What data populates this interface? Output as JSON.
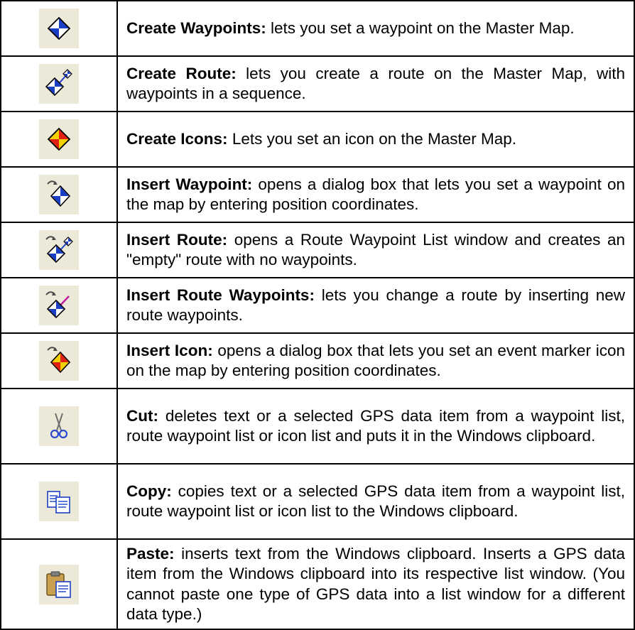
{
  "rows": [
    {
      "icon": "create-waypoint-icon",
      "title": "Create Waypoints:",
      "desc": " lets you set a waypoint on the Master Map."
    },
    {
      "icon": "create-route-icon",
      "title": "Create Route:",
      "desc": " lets you create a route on the Master Map, with waypoints in a sequence."
    },
    {
      "icon": "create-icons-icon",
      "title": "Create Icons:",
      "desc": " Lets you set an icon on the Master Map."
    },
    {
      "icon": "insert-waypoint-icon",
      "title": "Insert Waypoint:",
      "desc": " opens a dialog box that lets you set a waypoint on the map by entering position coordinates."
    },
    {
      "icon": "insert-route-icon",
      "title": "Insert Route:",
      "desc": " opens a Route Waypoint List window and creates an \"empty\" route with no waypoints."
    },
    {
      "icon": "insert-route-waypoints-icon",
      "title": "Insert Route Waypoints:",
      "desc": " lets you change a route by inserting new route waypoints."
    },
    {
      "icon": "insert-icon-icon",
      "title": "Insert Icon:",
      "desc": " opens a dialog box that lets you set an event marker icon on the map by entering position coordinates."
    },
    {
      "icon": "scissors-icon",
      "title": "Cut:",
      "desc": " deletes text or a selected GPS data item from a waypoint list, route waypoint list or icon list and puts it in the Windows clipboard."
    },
    {
      "icon": "copy-icon",
      "title": "Copy:",
      "desc": " copies text or a selected GPS data item from a waypoint list, route waypoint list or icon list to the Windows clipboard."
    },
    {
      "icon": "paste-icon",
      "title": "Paste:",
      "desc": " inserts text from the Windows clipboard. Inserts a GPS data item from the Windows clipboard into its respective list window. (You cannot paste one type of GPS data into a list window for a different data type.)"
    }
  ],
  "colors": {
    "icon_bg": "#ece9d8",
    "waypoint_blue": "#1a3fc4",
    "icon_red": "#e02010",
    "icon_yellow": "#f4d000",
    "arrow_gray": "#4a4a4a",
    "scissors_handle": "#2c4ad0",
    "clipboard_tan": "#c8a050"
  }
}
